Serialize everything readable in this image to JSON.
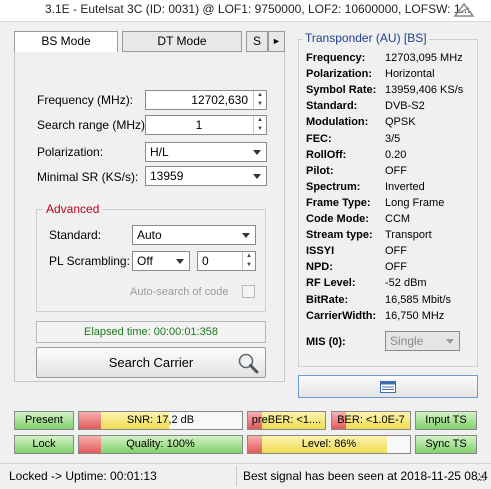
{
  "window": {
    "title": "3.1E - Eutelsat 3C (ID: 0031) @ LOF1: 9750000, LOF2: 10600000, LOFSW: 1..."
  },
  "tabs": [
    {
      "label": "BS Mode",
      "active": true
    },
    {
      "label": "DT Mode",
      "active": false
    },
    {
      "label": "S",
      "active": false
    }
  ],
  "form": {
    "frequency_label": "Frequency (MHz):",
    "frequency_value": "12702,630",
    "search_range_label": "Search range (MHz):",
    "search_range_value": "1",
    "polarization_label": "Polarization:",
    "polarization_value": "H/L",
    "min_sr_label": "Minimal SR (KS/s):",
    "min_sr_value": "13959"
  },
  "advanced": {
    "legend": "Advanced",
    "standard_label": "Standard:",
    "standard_value": "Auto",
    "pl_label": "PL Scrambling:",
    "pl_value": "Off",
    "pl_number": "0",
    "autosearch_label": "Auto-search of code",
    "autosearch_checked": false
  },
  "elapsed": "Elapsed time: 00:00:01:358",
  "search_button": "Search Carrier",
  "transponder": {
    "legend": "Transponder (AU) [BS]",
    "rows": [
      {
        "label": "Frequency:",
        "value": "12703,095 MHz"
      },
      {
        "label": "Polarization:",
        "value": "Horizontal"
      },
      {
        "label": "Symbol Rate:",
        "value": "13959,406 KS/s"
      },
      {
        "label": "Standard:",
        "value": "DVB-S2"
      },
      {
        "label": "Modulation:",
        "value": "QPSK"
      },
      {
        "label": "FEC:",
        "value": "3/5"
      },
      {
        "label": "RollOff:",
        "value": "0.20"
      },
      {
        "label": "Pilot:",
        "value": "OFF"
      },
      {
        "label": "Spectrum:",
        "value": "Inverted"
      },
      {
        "label": "Frame Type:",
        "value": "Long Frame"
      },
      {
        "label": "Code Mode:",
        "value": "CCM"
      },
      {
        "label": "Stream type:",
        "value": "Transport"
      },
      {
        "label": "ISSYI",
        "value": "OFF"
      },
      {
        "label": "NPD:",
        "value": "OFF"
      },
      {
        "label": "RF Level:",
        "value": "-52 dBm"
      },
      {
        "label": "BitRate:",
        "value": "16,585 Mbit/s"
      },
      {
        "label": "CarrierWidth:",
        "value": "16,750 MHz"
      }
    ],
    "mis_label": "MIS (0):",
    "mis_value": "Single"
  },
  "indicators": {
    "present": "Present",
    "lock": "Lock",
    "snr": "SNR: 17,2 dB",
    "snr_fraction": 0.55,
    "quality": "Quality: 100%",
    "quality_fraction": 1.0,
    "preber": "preBER: <1....",
    "ber": "BER: <1.0E-7",
    "level": "Level: 86%",
    "level_fraction": 0.86,
    "input_ts": "Input TS",
    "sync_ts": "Sync TS"
  },
  "status": {
    "left": "Locked -> Uptime: 00:01:13",
    "right": "Best signal has been seen at 2018-11-25 08:4"
  },
  "colors": {
    "green": "#7fd26a",
    "yellow": "#f2e26b",
    "red": "#e25b5b",
    "accent_blue": "#1f3f8f",
    "advanced_red": "#c0001a"
  }
}
